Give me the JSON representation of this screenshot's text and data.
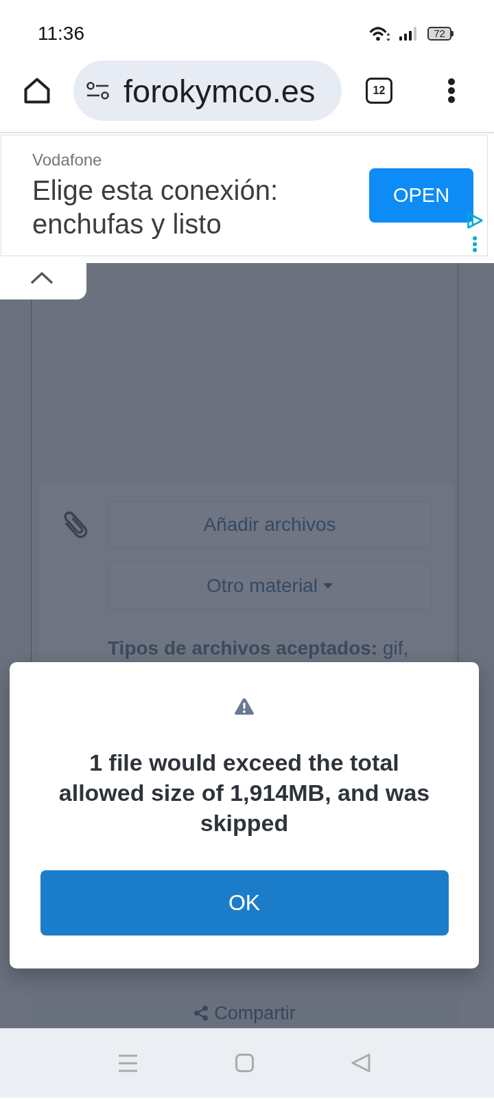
{
  "status_bar": {
    "time": "11:36",
    "battery": "72"
  },
  "browser": {
    "url": "forokymco.es",
    "tab_count": "12"
  },
  "ad": {
    "advertiser": "Vodafone",
    "headline": "Elige esta conexión: enchufas y listo",
    "button": "OPEN"
  },
  "page": {
    "attach_button": "Añadir archivos",
    "other_button": "Otro material",
    "accepted_types": "**Tipos de archivos aceptados:** gif,",
    "share_button": "Compartir"
  },
  "dialog": {
    "message": "1 file would exceed the total allowed size of 1,914MB, and was skipped",
    "button": "OK"
  }
}
